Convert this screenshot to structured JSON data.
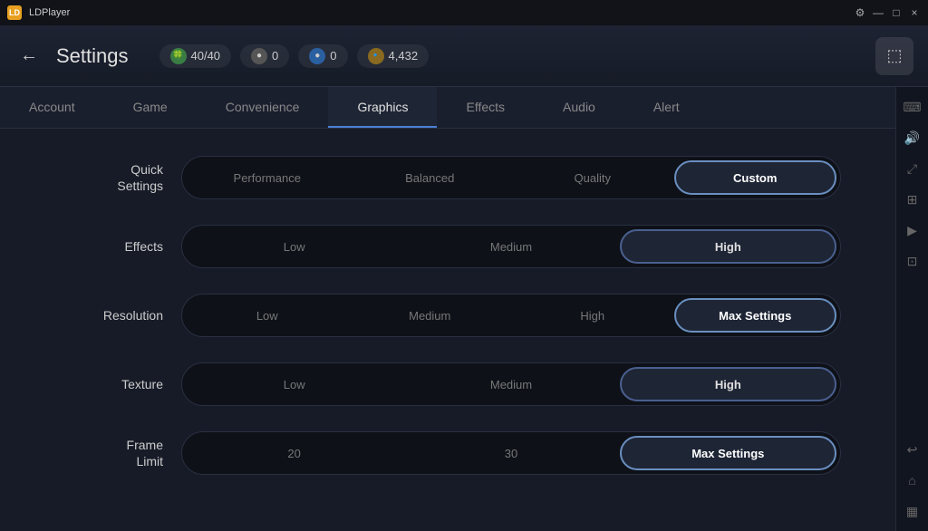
{
  "titleBar": {
    "logo": "LD",
    "title": "LDPlayer",
    "controls": [
      "⊟",
      "×"
    ]
  },
  "header": {
    "backLabel": "←",
    "title": "Settings",
    "stats": [
      {
        "icon": "🍀",
        "value": "40/40"
      },
      {
        "icon": "⬤",
        "value": "0"
      },
      {
        "icon": "⬤",
        "value": "0"
      },
      {
        "icon": "🔹",
        "value": "4,432"
      }
    ],
    "actionIcon": "⬚"
  },
  "tabs": [
    {
      "label": "Account",
      "active": false
    },
    {
      "label": "Game",
      "active": false
    },
    {
      "label": "Convenience",
      "active": false
    },
    {
      "label": "Graphics",
      "active": true
    },
    {
      "label": "Effects",
      "active": false
    },
    {
      "label": "Audio",
      "active": false
    },
    {
      "label": "Alert",
      "active": false
    }
  ],
  "settings": {
    "rows": [
      {
        "label": "Quick\nSettings",
        "options": [
          "Performance",
          "Balanced",
          "Quality",
          "Custom"
        ],
        "selected": "Custom"
      },
      {
        "label": "Effects",
        "options": [
          "Low",
          "Medium",
          "High"
        ],
        "selected": "High"
      },
      {
        "label": "Resolution",
        "options": [
          "Low",
          "Medium",
          "High",
          "Max Settings"
        ],
        "selected": "Max Settings"
      },
      {
        "label": "Texture",
        "options": [
          "Low",
          "Medium",
          "High"
        ],
        "selected": "High"
      },
      {
        "label": "Frame\nLimit",
        "options": [
          "20",
          "30",
          "Max Settings"
        ],
        "selected": "Max Settings"
      }
    ]
  },
  "sidebar": {
    "icons": [
      "⌨",
      "🔊",
      "↙",
      "⊞",
      "▶",
      "⊡",
      "↩",
      "⊟",
      "⊟"
    ]
  }
}
